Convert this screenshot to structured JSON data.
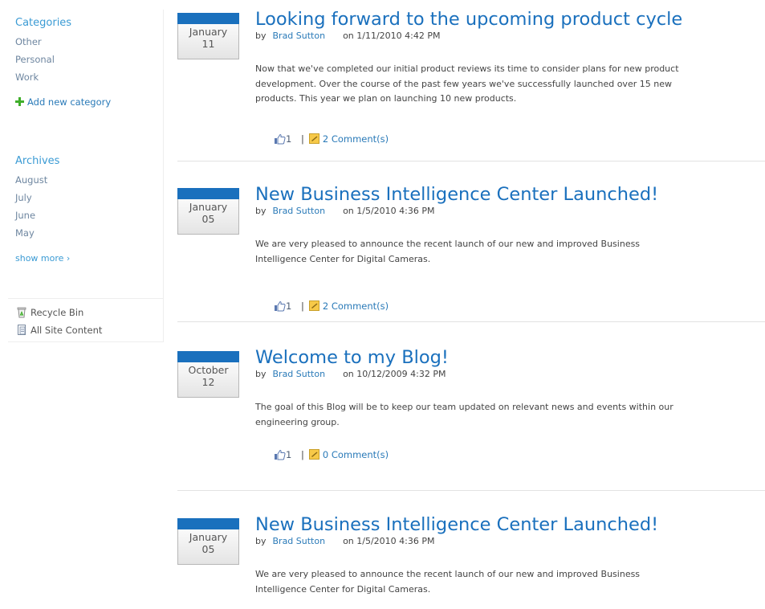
{
  "sidebar": {
    "categories_heading": "Categories",
    "categories": [
      "Other",
      "Personal",
      "Work"
    ],
    "add_category": "Add new category",
    "archives_heading": "Archives",
    "archives": [
      "August",
      "July",
      "June",
      "May"
    ],
    "show_more": "show more ›",
    "tools": [
      {
        "label": "Recycle Bin",
        "icon": "recycle-bin-icon"
      },
      {
        "label": "All Site Content",
        "icon": "document-icon"
      }
    ]
  },
  "colors": {
    "accent": "#1a70bd",
    "link": "#2a7ab8",
    "nav_heading": "#3b9bd4"
  },
  "posts": [
    {
      "month": "January",
      "day": "11",
      "title": "Looking forward to the upcoming product cycle",
      "by": "by",
      "author": "Brad Sutton",
      "posted": "on 1/11/2010 4:42 PM",
      "body": "Now that we've completed our initial product reviews its time to consider plans for new product development.  Over the course of the past few years we've successfully launched over 15 new products.  This year we plan on launching 10 new products.",
      "likes": "1",
      "comments": "2 Comment(s)"
    },
    {
      "month": "January",
      "day": "05",
      "title": "New Business Intelligence Center Launched!",
      "by": "by",
      "author": "Brad Sutton",
      "posted": "on 1/5/2010 4:36 PM",
      "body": "We are very pleased to announce the recent launch of our new and improved Business Intelligence Center for Digital Cameras.",
      "likes": "1",
      "comments": "2 Comment(s)"
    },
    {
      "month": "October",
      "day": "12",
      "title": "Welcome to my Blog!",
      "by": "by",
      "author": "Brad Sutton",
      "posted": "on 10/12/2009 4:32 PM",
      "body": "The goal of this Blog will be to keep our team updated on relevant news and events within our engineering group.",
      "likes": "1",
      "comments": "0 Comment(s)"
    },
    {
      "month": "January",
      "day": "05",
      "title": "New Business Intelligence Center Launched!",
      "by": "by",
      "author": "Brad Sutton",
      "posted": "on 1/5/2010 4:36 PM",
      "body": "We are very pleased to announce the recent launch of our new and improved Business Intelligence Center for Digital Cameras."
    }
  ]
}
